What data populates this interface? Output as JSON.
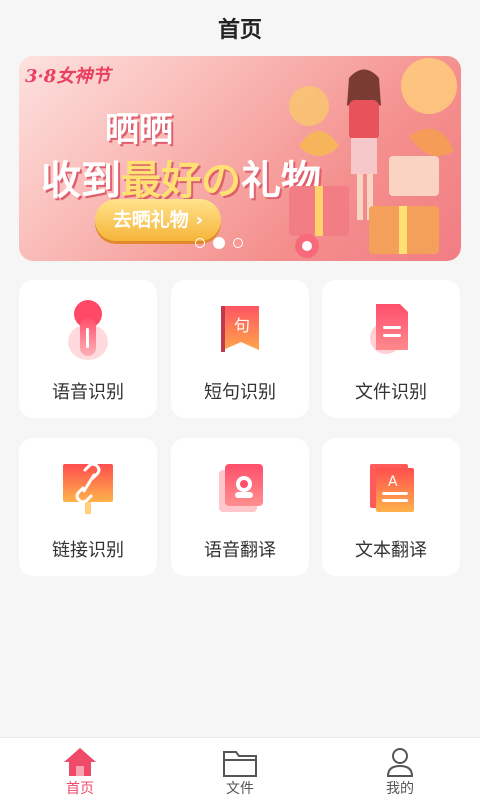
{
  "header": {
    "title": "首页"
  },
  "banner": {
    "tag": "3·8女神节",
    "line1": "晒晒",
    "line2_part1": "收到",
    "line2_highlight": "最好の",
    "line2_part2": "礼物",
    "cta": "去晒礼物 ›",
    "dots": 3,
    "active_dot": 1
  },
  "features": [
    {
      "label": "语音识别",
      "icon": "microphone-icon"
    },
    {
      "label": "短句识别",
      "icon": "sentence-icon"
    },
    {
      "label": "文件识别",
      "icon": "document-icon"
    },
    {
      "label": "链接识别",
      "icon": "link-icon"
    },
    {
      "label": "语音翻译",
      "icon": "voice-translate-icon"
    },
    {
      "label": "文本翻译",
      "icon": "text-translate-icon"
    }
  ],
  "tabbar": {
    "items": [
      {
        "label": "首页",
        "icon": "home-icon",
        "active": true
      },
      {
        "label": "文件",
        "icon": "folder-icon",
        "active": false
      },
      {
        "label": "我的",
        "icon": "profile-icon",
        "active": false
      }
    ]
  },
  "colors": {
    "accent": "#ef4a6a",
    "icon_gradient_top": "#ff4f6b",
    "icon_gradient_bottom": "#ffb24a"
  }
}
